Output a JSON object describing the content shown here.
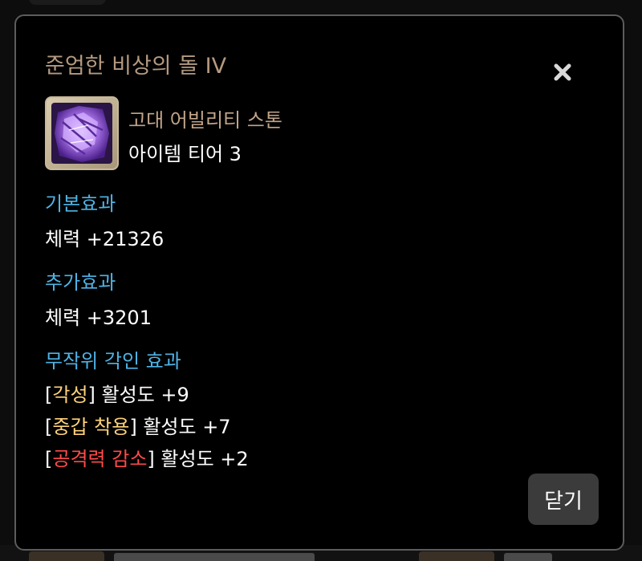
{
  "dialog": {
    "title": "준엄한 비상의 돌 IV",
    "close_icon": "close-x-icon",
    "item": {
      "icon": "ability-stone-icon",
      "type": "고대 어빌리티 스톤",
      "tier": "아이템 티어 3"
    },
    "basic_effect": {
      "heading": "기본효과",
      "value": "체력 +21326"
    },
    "additional_effect": {
      "heading": "추가효과",
      "value": "체력 +3201"
    },
    "random_engravings": {
      "heading": "무작위 각인 효과",
      "items": [
        {
          "name": "각성",
          "suffix": "활성도 +9",
          "color": "#ffd27a"
        },
        {
          "name": "중갑 착용",
          "suffix": "활성도 +7",
          "color": "#ffd27a"
        },
        {
          "name": "공격력 감소",
          "suffix": "활성도 +2",
          "color": "#ff4a4a"
        }
      ]
    },
    "close_button_label": "닫기"
  },
  "colors": {
    "title": "#b49a80",
    "section_heading": "#4fb3e6",
    "item_type": "#c2a58a",
    "dialog_border": "#5c5c5c"
  }
}
